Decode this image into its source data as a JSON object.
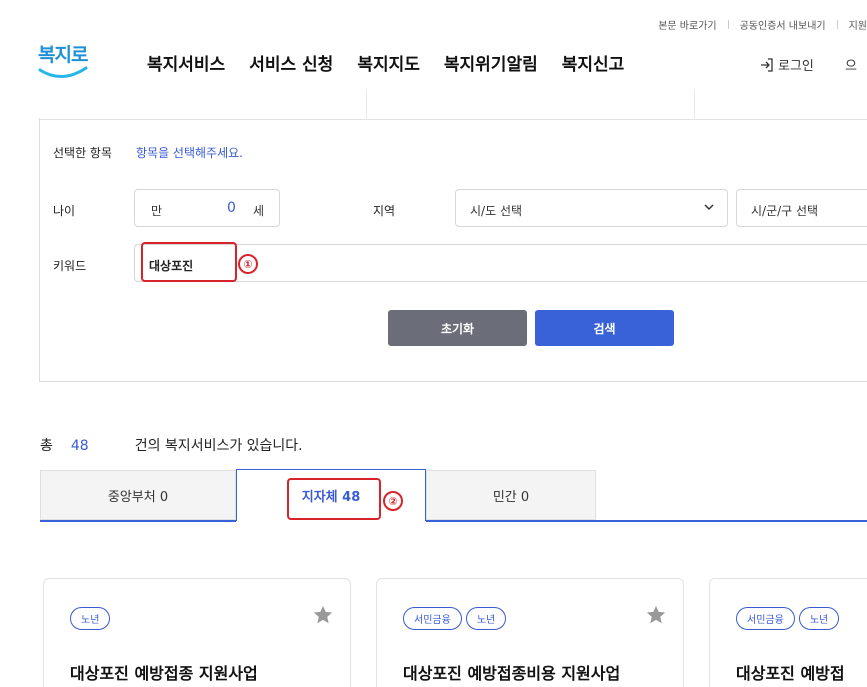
{
  "utility": {
    "skip": "본문 바로가기",
    "cert": "공동인증서 내보내기",
    "support": "지원"
  },
  "header": {
    "logo": "복지로",
    "nav": [
      "복지서비스",
      "서비스 신청",
      "복지지도",
      "복지위기알림",
      "복지신고"
    ],
    "login": "로그인",
    "extra": "으"
  },
  "search": {
    "selected_label": "선택한 항목",
    "selected_hint": "항목을 선택해주세요.",
    "age_label": "나이",
    "age_prefix": "만",
    "age_value": "0",
    "age_unit": "세",
    "region_label": "지역",
    "sido_placeholder": "시/도 선택",
    "sigungu_placeholder": "시/군/구 선택",
    "keyword_label": "키워드",
    "keyword_value": "대상포진",
    "annotation1": "①",
    "reset_label": "초기화",
    "search_label": "검색"
  },
  "results": {
    "total_prefix": "총",
    "total_count": "48",
    "total_suffix": "건의 복지서비스가 있습니다.",
    "tabs": [
      "중앙부처 0",
      "지자체 48",
      "민간 0"
    ],
    "annotation2": "②"
  },
  "cards": [
    {
      "tags": [
        "노년"
      ],
      "title": "대상포진 예방접종 지원사업"
    },
    {
      "tags": [
        "서민금융",
        "노년"
      ],
      "title": "대상포진 예방접종비용 지원사업"
    },
    {
      "tags": [
        "서민금융",
        "노년"
      ],
      "title": "대상포진 예방접"
    }
  ],
  "colors": {
    "accent": "#3a62d8",
    "annotation_red": "#d8232a",
    "reset_button": "#6b6e78"
  }
}
